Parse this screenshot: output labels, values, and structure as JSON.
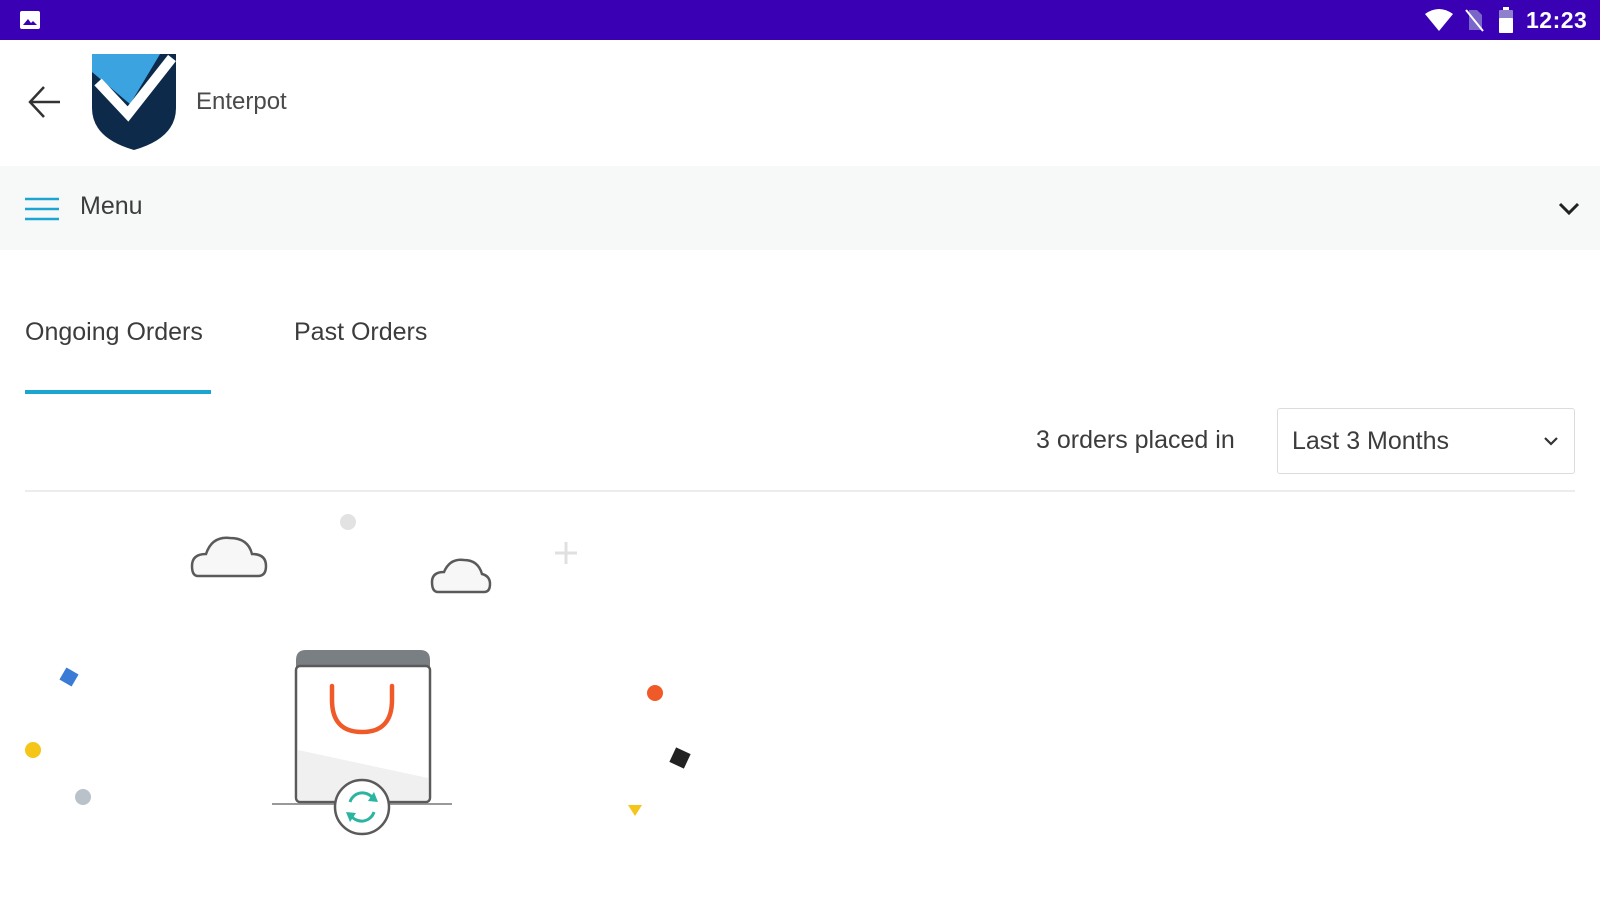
{
  "status_bar": {
    "time": "12:23",
    "icons": [
      "gallery-icon",
      "wifi-icon",
      "no-sim-icon",
      "battery-icon"
    ],
    "background": "#3a00b4"
  },
  "header": {
    "brand_name": "Enterpot",
    "back_icon": "arrow-left-icon",
    "logo": "shield-check-logo"
  },
  "menu": {
    "label": "Menu",
    "icon": "hamburger-icon",
    "expand_icon": "chevron-down-icon"
  },
  "tabs": [
    {
      "label": "Ongoing Orders",
      "active": true
    },
    {
      "label": "Past Orders",
      "active": false
    }
  ],
  "filter": {
    "count_text": "3 orders placed in",
    "period_selected": "Last 3 Months"
  },
  "colors": {
    "accent": "#1ba5d0",
    "status_bar": "#3a00b4",
    "logo_blue": "#3ba3e0",
    "logo_navy": "#0d2a4a",
    "bag_handle": "#f05a28",
    "refresh_icon": "#2bb5a0"
  }
}
